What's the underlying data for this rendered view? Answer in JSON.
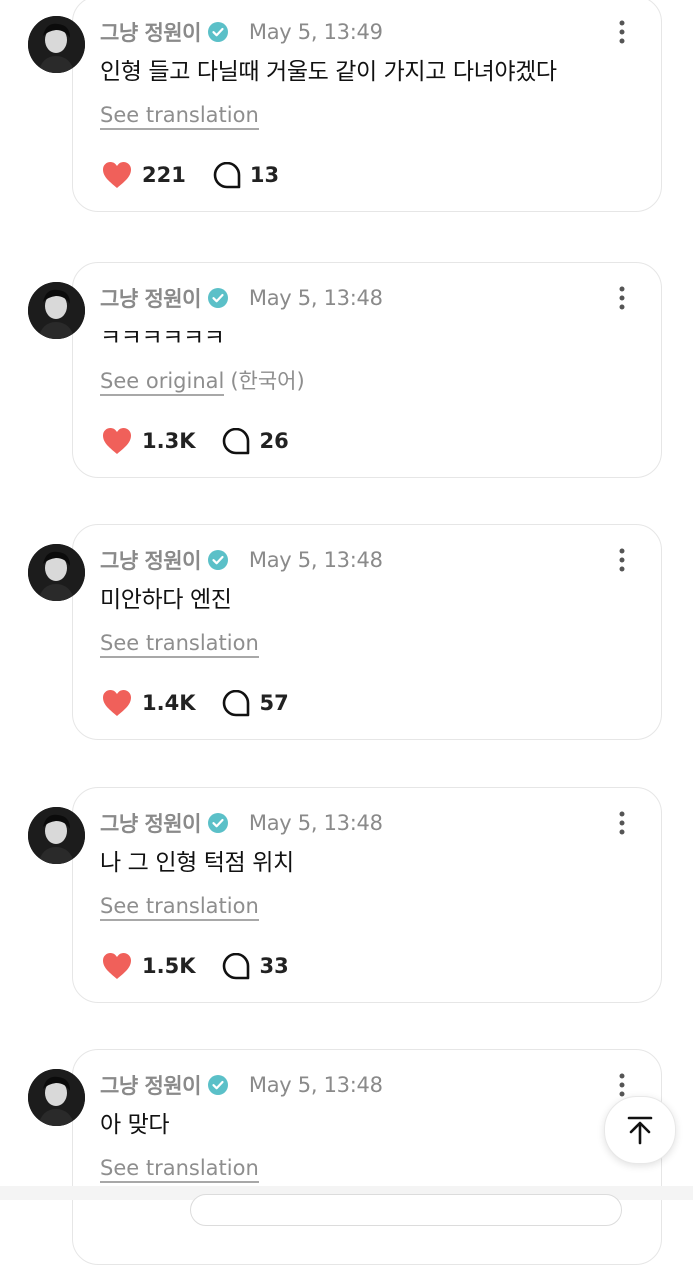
{
  "posts": [
    {
      "author": "그냥 정원이",
      "time": "May 5, 13:49",
      "text": "인형 들고 다닐때 거울도 같이 가지고 다녀야겠다",
      "translation_link": "See translation",
      "language": "",
      "likes": "221",
      "replies": "13"
    },
    {
      "author": "그냥 정원이",
      "time": "May 5, 13:48",
      "text": "ㅋㅋㅋㅋㅋㅋ",
      "translation_link": "See original",
      "language": "(한국어)",
      "likes": "1.3K",
      "replies": "26"
    },
    {
      "author": "그냥 정원이",
      "time": "May 5, 13:48",
      "text": "미안하다 엔진",
      "translation_link": "See translation",
      "language": "",
      "likes": "1.4K",
      "replies": "57"
    },
    {
      "author": "그냥 정원이",
      "time": "May 5, 13:48",
      "text": "나 그 인형 턱점 위치",
      "translation_link": "See translation",
      "language": "",
      "likes": "1.5K",
      "replies": "33"
    },
    {
      "author": "그냥 정원이",
      "time": "May 5, 13:48",
      "text": "아 맞다",
      "translation_link": "See translation",
      "language": "",
      "likes": "",
      "replies": ""
    }
  ],
  "icons": {
    "verified": "verified-badge-icon",
    "more": "more-vertical-icon",
    "like": "heart-icon",
    "reply": "reply-bubble-icon",
    "scroll_top": "arrow-up-to-top-icon"
  },
  "colors": {
    "like_red": "#f0605a",
    "verified_teal": "#5bc0c8",
    "muted_text": "#8a8a8a"
  }
}
